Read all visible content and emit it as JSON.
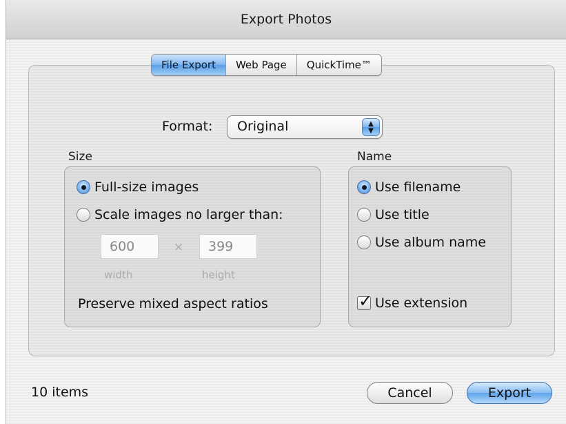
{
  "window": {
    "title": "Export Photos"
  },
  "tabs": [
    {
      "label": "File Export",
      "active": true
    },
    {
      "label": "Web Page",
      "active": false
    },
    {
      "label": "QuickTime™",
      "active": false
    }
  ],
  "format": {
    "label": "Format:",
    "value": "Original"
  },
  "size": {
    "label": "Size",
    "options": [
      {
        "label": "Full-size images",
        "selected": true
      },
      {
        "label": "Scale images no larger than:",
        "selected": false
      }
    ],
    "width_value": "600",
    "height_value": "399",
    "times_symbol": "×",
    "width_label": "width",
    "height_label": "height",
    "preserve_label": "Preserve mixed aspect ratios"
  },
  "name": {
    "label": "Name",
    "options": [
      {
        "label": "Use filename",
        "selected": true
      },
      {
        "label": "Use title",
        "selected": false
      },
      {
        "label": "Use album name",
        "selected": false
      }
    ],
    "extension": {
      "label": "Use extension",
      "checked": true
    }
  },
  "footer": {
    "item_count": "10 items",
    "cancel_label": "Cancel",
    "export_label": "Export"
  },
  "colors": {
    "accent": "#5a9fe6",
    "window_bg": "#efefef"
  }
}
